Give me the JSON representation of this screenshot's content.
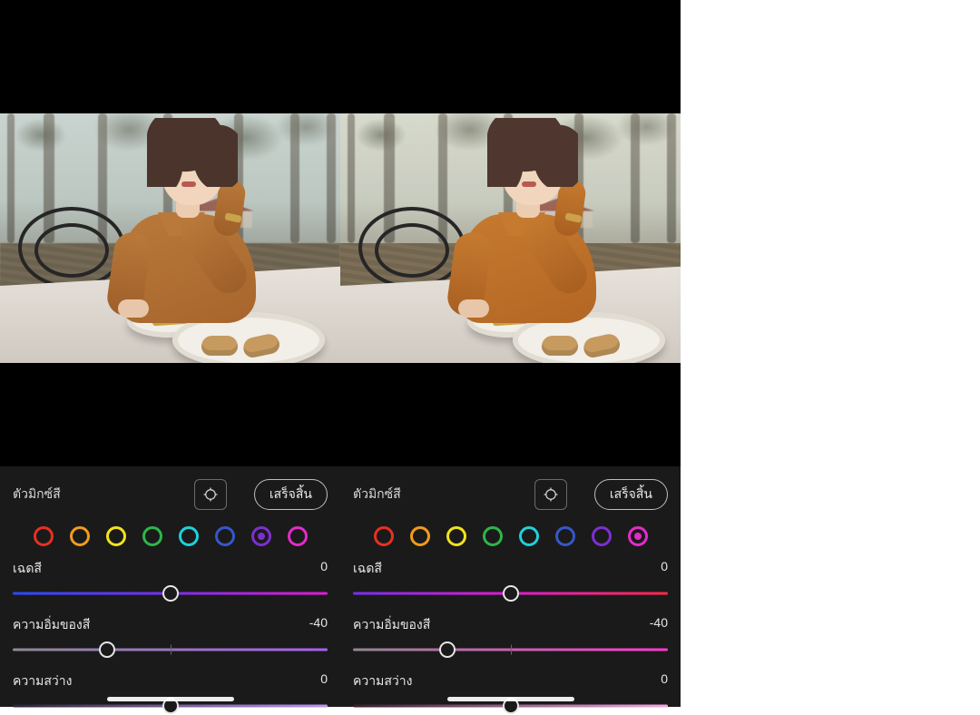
{
  "panes": [
    {
      "panel": {
        "title": "ตัวมิกซ์สี",
        "done_label": "เสร็จสิ้น",
        "swatches": [
          "red",
          "orange",
          "yellow",
          "green",
          "cyan",
          "blue",
          "purple",
          "magenta"
        ],
        "selected_swatch": "purple",
        "sliders": {
          "hue": {
            "label": "เฉดสี",
            "value": "0",
            "pos_pct": 50
          },
          "saturation": {
            "label": "ความอิ่มของสี",
            "value": "-40",
            "pos_pct": 30
          },
          "luminance": {
            "label": "ความสว่าง",
            "value": "0",
            "pos_pct": 50
          }
        }
      }
    },
    {
      "panel": {
        "title": "ตัวมิกซ์สี",
        "done_label": "เสร็จสิ้น",
        "swatches": [
          "red",
          "orange",
          "yellow",
          "green",
          "cyan",
          "blue",
          "purple",
          "magenta"
        ],
        "selected_swatch": "magenta",
        "sliders": {
          "hue": {
            "label": "เฉดสี",
            "value": "0",
            "pos_pct": 50
          },
          "saturation": {
            "label": "ความอิ่มของสี",
            "value": "-40",
            "pos_pct": 30
          },
          "luminance": {
            "label": "ความสว่าง",
            "value": "0",
            "pos_pct": 50
          }
        }
      }
    }
  ]
}
